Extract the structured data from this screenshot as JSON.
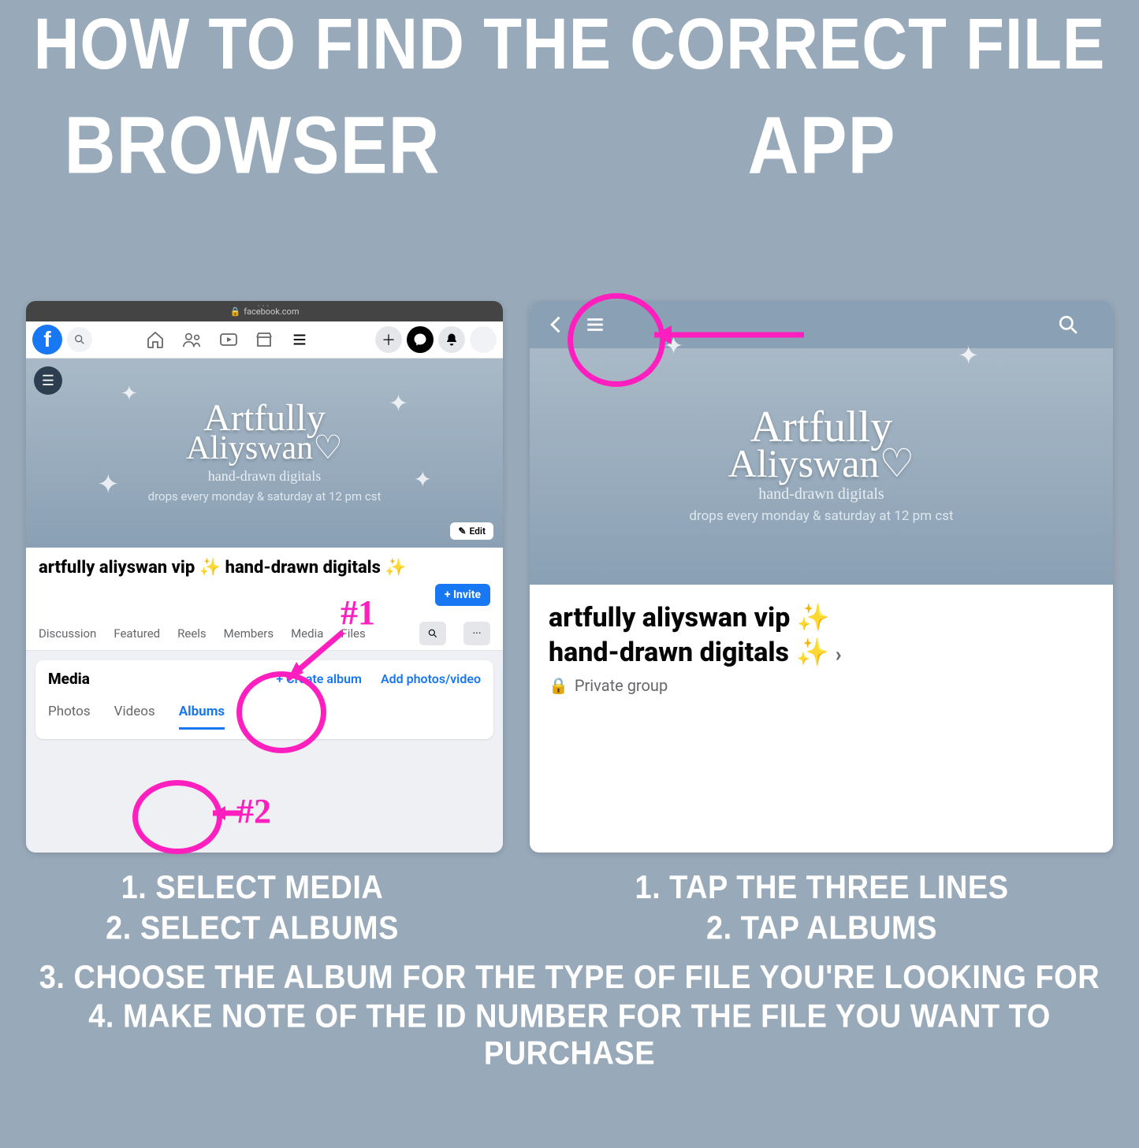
{
  "title": "HOW TO FIND THE CORRECT FILE",
  "columns": {
    "left": "BROWSER",
    "right": "APP"
  },
  "browser": {
    "url_label": "facebook.com",
    "cover": {
      "brand_line1": "Artfully",
      "brand_line2": "Aliyswan",
      "tagline": "hand-drawn digitals",
      "drops": "drops every monday & saturday at 12 pm cst",
      "edit": "Edit"
    },
    "group_title": "artfully aliyswan vip ✨ hand-drawn digitals ✨",
    "invite": "+ Invite",
    "tabs": [
      "Discussion",
      "Featured",
      "Reels",
      "Members",
      "Media",
      "Files"
    ],
    "media_section": {
      "heading": "Media",
      "create_album": "+  Create album",
      "add_photos": "Add photos/video",
      "subtabs": {
        "photos": "Photos",
        "videos": "Videos",
        "albums": "Albums"
      }
    },
    "annotations": {
      "one": "#1",
      "two": "#2"
    }
  },
  "app": {
    "cover": {
      "brand_line1": "Artfully",
      "brand_line2": "Aliyswan",
      "tagline": "hand-drawn digitals",
      "drops": "drops every monday & saturday at 12 pm cst"
    },
    "group_title_line1": "artfully aliyswan vip ✨",
    "group_title_line2": "hand-drawn digitals ✨",
    "private": "Private group"
  },
  "instructions": {
    "browser": [
      "1. SELECT MEDIA",
      "2. SELECT ALBUMS"
    ],
    "app": [
      "1. TAP THE THREE LINES",
      "2. TAP ALBUMS"
    ],
    "shared": [
      "3. CHOOSE THE ALBUM FOR THE TYPE OF FILE YOU'RE LOOKING FOR",
      "4. MAKE NOTE OF THE ID NUMBER FOR THE FILE YOU WANT TO PURCHASE"
    ]
  }
}
